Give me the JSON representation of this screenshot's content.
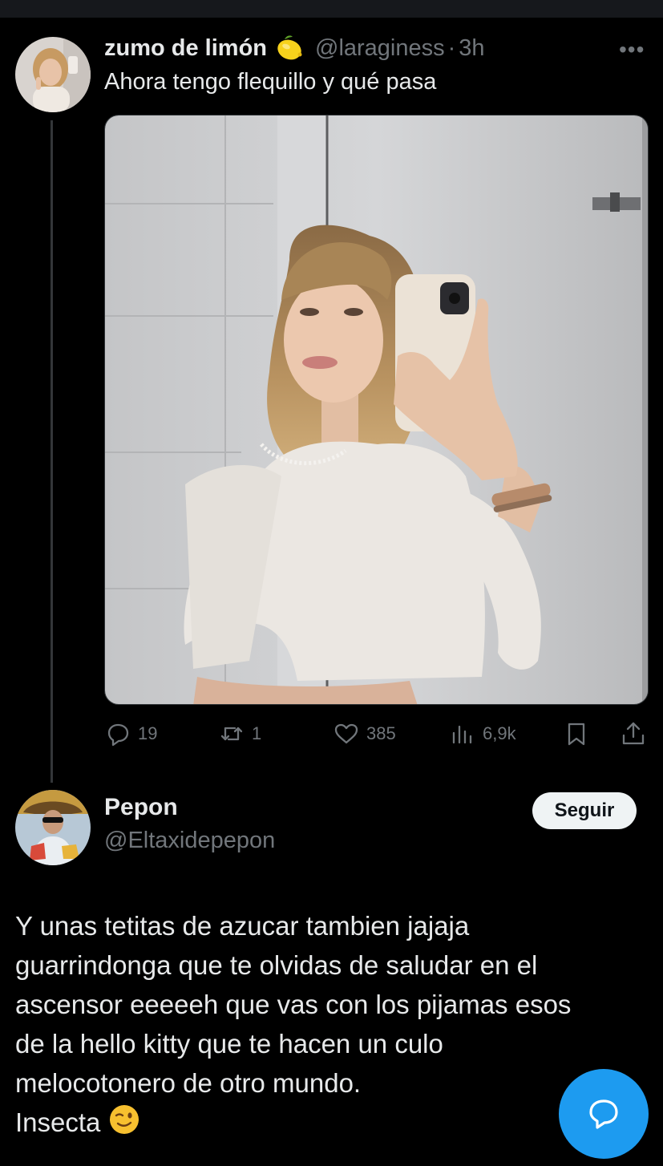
{
  "post": {
    "display_name": "zumo de limón",
    "name_emoji": "lemon-emoji",
    "handle": "@laraginess",
    "separator": "·",
    "time": "3h",
    "more_label": "•••",
    "text": "Ahora tengo flequillo y qué pasa",
    "image_alt": "mirror-selfie-photo",
    "stats": {
      "replies": "19",
      "reposts": "1",
      "likes": "385",
      "views": "6,9k"
    }
  },
  "reply": {
    "display_name": "Pepon",
    "handle": "@Eltaxidepepon",
    "follow_label": "Seguir",
    "lines": [
      "Y unas tetitas de azucar tambien jajaja",
      "guarrindonga que te olvidas de saludar en el",
      "ascensor eeeeeh que vas con los pijamas esos",
      "de la hello kitty que te hacen un culo",
      "melocotonero de otro mundo.",
      "Insecta"
    ],
    "emoji": "winking-face-emoji"
  },
  "colors": {
    "background": "#000000",
    "text": "#e7e9ea",
    "muted": "#71767b",
    "accent": "#1d9bf0"
  }
}
